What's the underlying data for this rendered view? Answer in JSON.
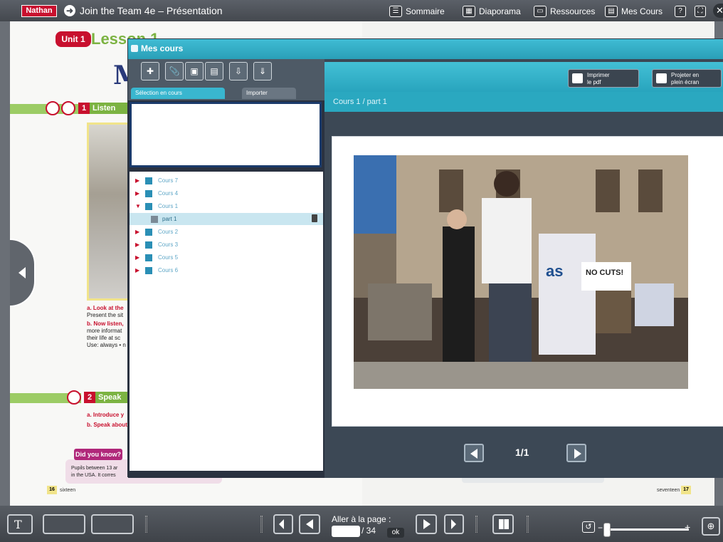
{
  "topbar": {
    "brand": "Nathan",
    "title": "Join the Team 4e – Présentation",
    "nav": [
      {
        "label": "Sommaire",
        "icon": "list-icon"
      },
      {
        "label": "Diaporama",
        "icon": "slideshow-icon"
      },
      {
        "label": "Ressources",
        "icon": "folder-icon"
      },
      {
        "label": "Mes Cours",
        "icon": "courses-icon"
      }
    ],
    "help_glyph": "?"
  },
  "book": {
    "unit": "Unit 1",
    "lesson": "Lesson 1",
    "big_letter": "M",
    "section1_num": "1",
    "section1_label": "Listen",
    "section2_num": "2",
    "section2_label": "Speak",
    "instr_a": "a. Look at the",
    "instr_a2": "Present the sit",
    "instr_b": "b. Now listen,",
    "instr_b2": "more informat",
    "instr_b3": "their life at sc",
    "instr_use": "Use: always • n",
    "speak_a": "a. Introduce y",
    "speak_b": "b. Speak about",
    "know_badge": "Did you know?",
    "know_text1": "Pupils between 13 ar",
    "know_text2": "in the USA. It corres",
    "left_page_num": "16",
    "left_page_word": "sixteen",
    "right_page_num": "17",
    "right_page_word": "seventeen"
  },
  "panel": {
    "title": "Mes cours",
    "tab_selection": "Sélection en cours",
    "tab_import": "Importer",
    "print_label": "Imprimer\nle pdf",
    "project_label": "Projeter en\nplein écran",
    "path": "Cours 1 / part 1",
    "tree": [
      {
        "label": "Cours 7",
        "selected": false,
        "expanded": false,
        "child": false
      },
      {
        "label": "Cours 4",
        "selected": false,
        "expanded": false,
        "child": false
      },
      {
        "label": "Cours 1",
        "selected": false,
        "expanded": true,
        "child": false
      },
      {
        "label": "part 1",
        "selected": true,
        "expanded": false,
        "child": true
      },
      {
        "label": "Cours 2",
        "selected": false,
        "expanded": false,
        "child": false
      },
      {
        "label": "Cours 3",
        "selected": false,
        "expanded": false,
        "child": false
      },
      {
        "label": "Cours 5",
        "selected": false,
        "expanded": false,
        "child": false
      },
      {
        "label": "Cours 6",
        "selected": false,
        "expanded": false,
        "child": false
      }
    ],
    "pager": "1/1",
    "photo_sign": "NO CUTS!"
  },
  "bottombar": {
    "goto_label": "Aller à la page :",
    "page_total": "/ 34",
    "ok_label": "ok",
    "page_value": ""
  },
  "colors": {
    "accent_cyan": "#2aa8c0",
    "brand_red": "#c8102e",
    "lesson_green": "#7cb342"
  }
}
